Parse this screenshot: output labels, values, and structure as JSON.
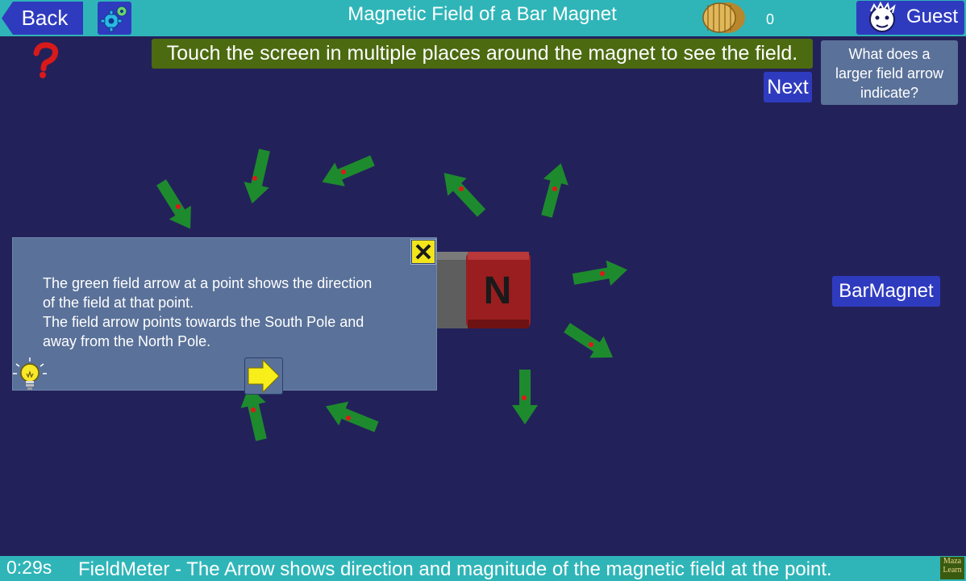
{
  "header": {
    "back_label": "Back",
    "title": "Magnetic Field of a Bar Magnet",
    "coin_count": "0",
    "user_label": "Guest"
  },
  "instruction": "Touch the screen in multiple places around the magnet to see the field.",
  "next_label": "Next",
  "question": {
    "lines": [
      "What does a",
      "larger field arrow",
      "indicate?"
    ]
  },
  "barmagnet_label": "BarMagnet",
  "magnet": {
    "pole_label": "N"
  },
  "info_panel": {
    "lines": [
      "The green field arrow at a point shows the direction",
      "of the field at that point.",
      "The field arrow points towards the South Pole and",
      "away from the North Pole."
    ]
  },
  "status": {
    "timer": "0:29s",
    "message": "FieldMeter - The Arrow shows direction and magnitude of the magnetic field at the point."
  },
  "brand": {
    "lines": [
      "Maza",
      "Learn"
    ]
  },
  "colors": {
    "background": "#23215a",
    "bar": "#2fb5b8",
    "button": "#2f3bbf",
    "panel": "#5a7199",
    "instruction_bg": "#4c6a10",
    "field_arrow": "#1e8a2e",
    "probe_dot": "#e01818",
    "magnet_north": "#9a1e20",
    "magnet_south": "#5e5e5e"
  },
  "icons": [
    "gear-icon",
    "coins-icon",
    "user-avatar-icon",
    "help-question-icon",
    "close-icon",
    "lightbulb-icon",
    "next-arrow-icon"
  ]
}
